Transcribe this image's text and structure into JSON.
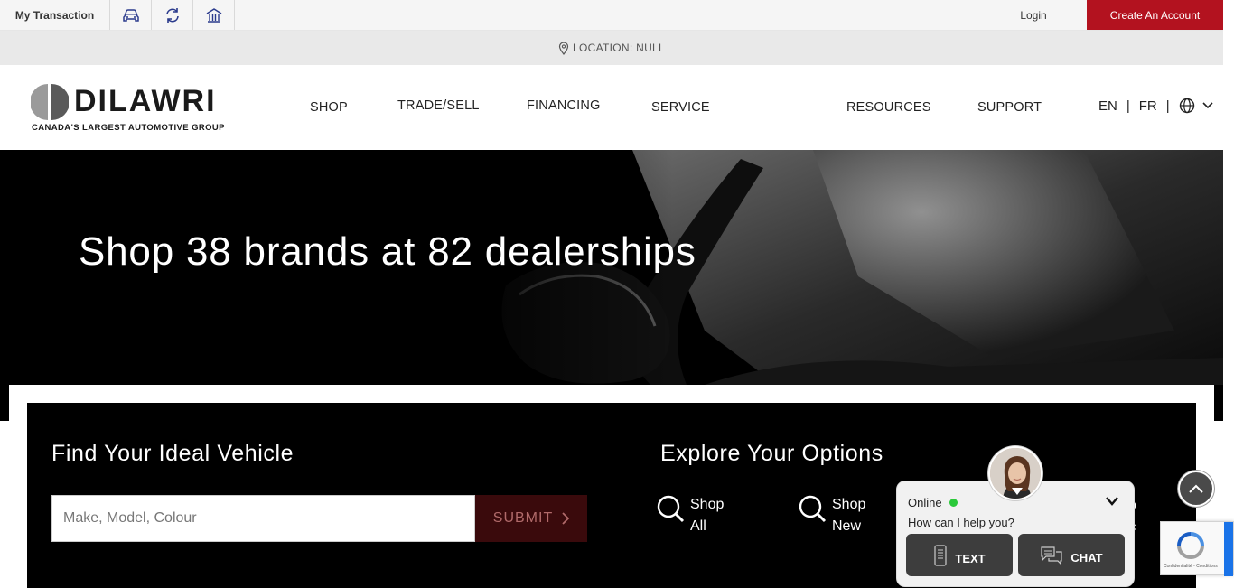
{
  "topbar": {
    "my_transaction": "My Transaction",
    "icons": [
      "car-icon",
      "refresh-icon",
      "dealership-icon"
    ],
    "login": "Login",
    "create_account": "Create An Account",
    "accent_color": "#b3121f"
  },
  "location": {
    "label": "LOCATION: NULL"
  },
  "logo": {
    "wordmark": "DILAWRI",
    "tagline": "CANADA'S LARGEST AUTOMOTIVE GROUP"
  },
  "nav": {
    "shop": "SHOP",
    "trade_sell": "TRADE/SELL",
    "financing": "FINANCING",
    "service": "SERVICE",
    "resources": "RESOURCES",
    "support": "SUPPORT"
  },
  "languages": {
    "en": "EN",
    "fr": "FR",
    "separator": "|"
  },
  "hero": {
    "headline": "Shop 38 brands at 82 dealerships"
  },
  "search": {
    "title": "Find Your Ideal Vehicle",
    "placeholder": "Make, Model, Colour",
    "submit": "SUBMIT"
  },
  "explore": {
    "title": "Explore Your Options",
    "options": [
      {
        "line1": "Shop",
        "line2": "All"
      },
      {
        "line1": "Shop",
        "line2": "New"
      }
    ],
    "partial": {
      "line1": "o",
      "line2": "tric"
    }
  },
  "chat": {
    "status": "Online",
    "prompt": "How can I help you?",
    "text_button": "TEXT",
    "chat_button": "CHAT",
    "status_color": "#2bc93a"
  },
  "recaptcha": {
    "footer": "Confidentialité - Conditions"
  }
}
